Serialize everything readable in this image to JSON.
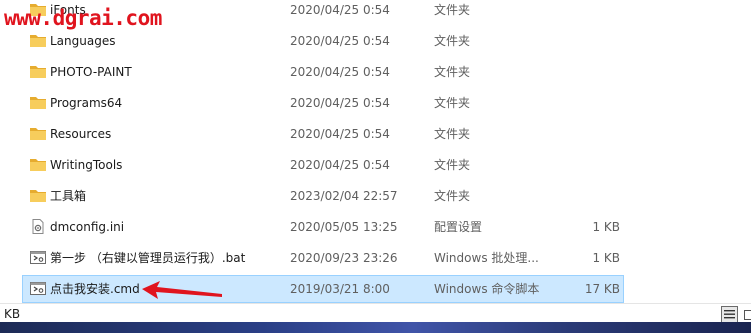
{
  "watermark": "www.dgrai.com",
  "files": [
    {
      "name": "iFonts",
      "date": "2020/04/25 0:54",
      "type": "文件夹",
      "size": "",
      "icon": "folder-icon",
      "top": -1
    },
    {
      "name": "Languages",
      "date": "2020/04/25 0:54",
      "type": "文件夹",
      "size": "",
      "icon": "folder-icon"
    },
    {
      "name": "PHOTO-PAINT",
      "date": "2020/04/25 0:54",
      "type": "文件夹",
      "size": "",
      "icon": "folder-icon"
    },
    {
      "name": "Programs64",
      "date": "2020/04/25 0:54",
      "type": "文件夹",
      "size": "",
      "icon": "folder-icon"
    },
    {
      "name": "Resources",
      "date": "2020/04/25 0:54",
      "type": "文件夹",
      "size": "",
      "icon": "folder-icon"
    },
    {
      "name": "WritingTools",
      "date": "2020/04/25 0:54",
      "type": "文件夹",
      "size": "",
      "icon": "folder-icon"
    },
    {
      "name": "工具箱",
      "date": "2023/02/04 22:57",
      "type": "文件夹",
      "size": "",
      "icon": "folder-icon"
    },
    {
      "name": "dmconfig.ini",
      "date": "2020/05/05 13:25",
      "type": "配置设置",
      "size": "1 KB",
      "icon": "settings-file-icon"
    },
    {
      "name": "第一步 （右键以管理员运行我）.bat",
      "date": "2020/09/23 23:26",
      "type": "Windows 批处理...",
      "size": "1 KB",
      "icon": "batch-file-icon"
    },
    {
      "name": "点击我安装.cmd",
      "date": "2019/03/21 8:00",
      "type": "Windows 命令脚本",
      "size": "17 KB",
      "icon": "batch-file-icon",
      "selected": true
    }
  ],
  "status": {
    "text": "KB"
  },
  "colors": {
    "folder": "#f0c24a",
    "selection": "#cce8ff",
    "watermark": "#e0141e",
    "arrow": "#e0141e"
  }
}
